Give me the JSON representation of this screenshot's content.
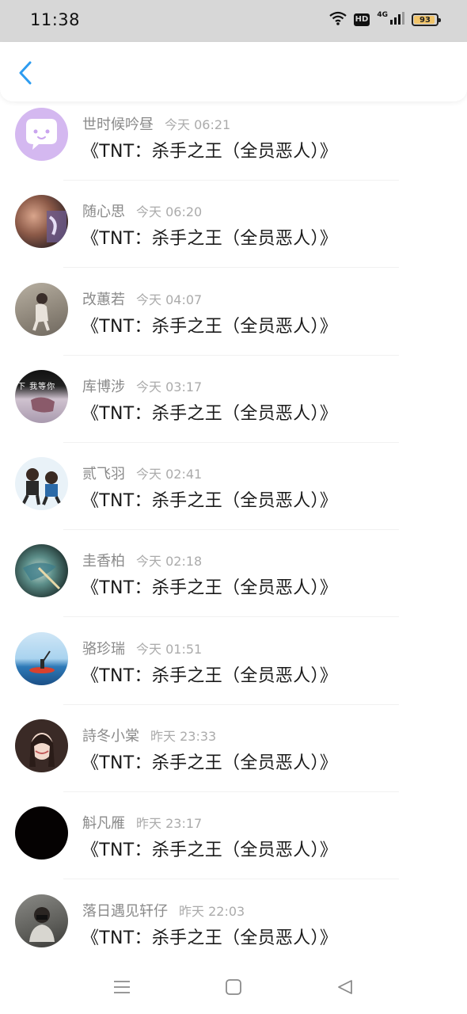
{
  "status_bar": {
    "time": "11:38",
    "hd_label": "HD",
    "network_label": "4G",
    "battery_level": "93"
  },
  "header": {
    "back_icon": "chevron-left-icon",
    "accent_color": "#2d9cf0"
  },
  "comments": [
    {
      "name": "世时候吟昼",
      "time": "今天 06:21",
      "message": "《TNT：杀手之王（全员恶人）》"
    },
    {
      "name": "随心思",
      "time": "今天 06:20",
      "message": "《TNT：杀手之王（全员恶人）》"
    },
    {
      "name": "改蕙若",
      "time": "今天 04:07",
      "message": "《TNT：杀手之王（全员恶人）》"
    },
    {
      "name": "库博涉",
      "time": "今天 03:17",
      "message": "《TNT：杀手之王（全员恶人）》",
      "avatar_text": "下 我等你"
    },
    {
      "name": "贰飞羽",
      "time": "今天 02:41",
      "message": "《TNT：杀手之王（全员恶人）》"
    },
    {
      "name": "圭香柏",
      "time": "今天 02:18",
      "message": "《TNT：杀手之王（全员恶人）》"
    },
    {
      "name": "骆珍瑞",
      "time": "今天 01:51",
      "message": "《TNT：杀手之王（全员恶人）》"
    },
    {
      "name": "詩冬小棠",
      "time": "昨天 23:33",
      "message": "《TNT：杀手之王（全员恶人）》"
    },
    {
      "name": "斛凡雁",
      "time": "昨天 23:17",
      "message": "《TNT：杀手之王（全员恶人）》"
    },
    {
      "name": "落日遇见轩仔",
      "time": "昨天 22:03",
      "message": "《TNT：杀手之王（全员恶人）》"
    }
  ],
  "nav_bar": {
    "menu_icon": "menu-icon",
    "home_icon": "home-square-icon",
    "back_icon": "back-triangle-icon"
  }
}
